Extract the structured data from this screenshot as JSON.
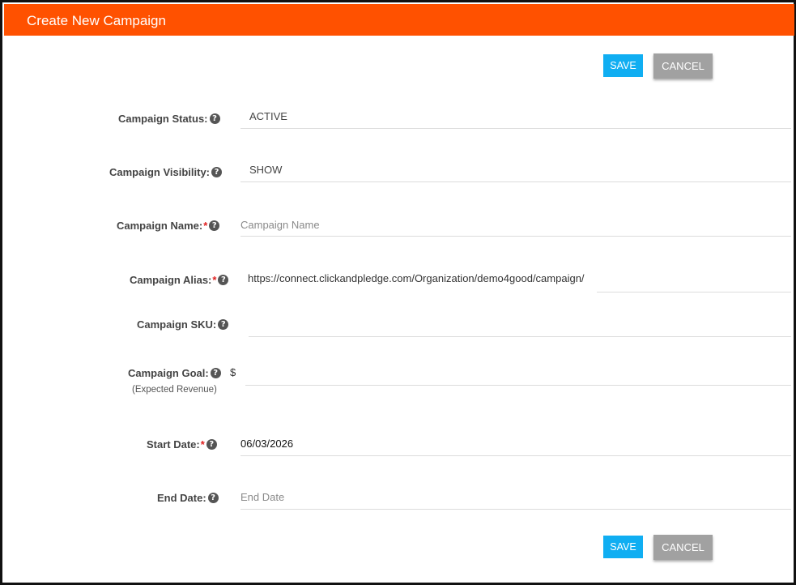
{
  "header": {
    "title": "Create New Campaign"
  },
  "toolbar": {
    "save_label": "SAVE",
    "cancel_label": "CANCEL"
  },
  "footer_toolbar": {
    "save_label": "SAVE",
    "cancel_label": "CANCEL"
  },
  "form": {
    "status": {
      "label": "Campaign Status:",
      "value": "ACTIVE"
    },
    "visibility": {
      "label": "Campaign Visibility:",
      "value": "SHOW"
    },
    "name": {
      "label": "Campaign Name:",
      "required_mark": "*",
      "placeholder": "Campaign Name"
    },
    "alias": {
      "label": "Campaign Alias:",
      "required_mark": "*",
      "prefix": "https://connect.clickandpledge.com/Organization/demo4good/campaign/"
    },
    "sku": {
      "label": "Campaign SKU:",
      "value": ""
    },
    "goal": {
      "label": "Campaign Goal:",
      "sublabel": "(Expected Revenue)",
      "currency": "$",
      "value": ""
    },
    "start_date": {
      "label": "Start Date:",
      "required_mark": "*",
      "value": "06/03/2026"
    },
    "end_date": {
      "label": "End Date:",
      "placeholder": "End Date"
    }
  },
  "icons": {
    "help": "help-icon",
    "help_glyph": "?"
  },
  "colors": {
    "header": "#ff5100",
    "save": "#10aef2",
    "cancel": "#a1a1a1",
    "required": "#e02020"
  }
}
